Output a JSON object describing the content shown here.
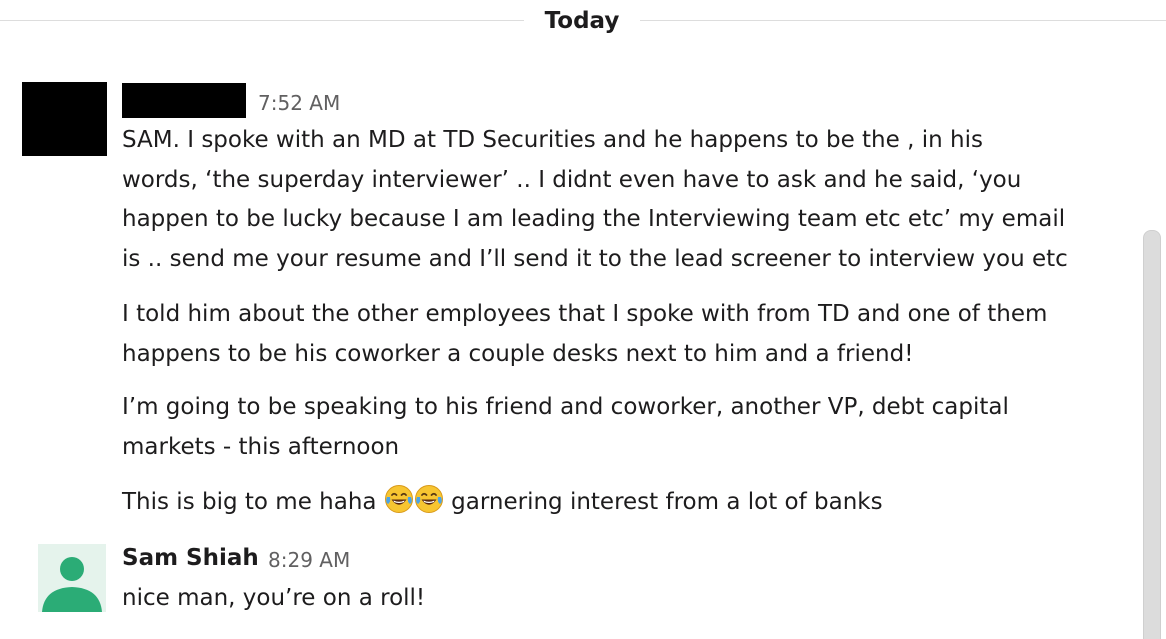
{
  "divider": {
    "label": "Today"
  },
  "messages": [
    {
      "sender_redacted": true,
      "time": "7:52 AM",
      "paragraphs": [
        {
          "lines": [
            "SAM. I spoke with an MD at TD Securities and he happens to be the , in his",
            "words, ‘the superday interviewer’ .. I didnt even have to ask and he said, ‘you",
            "happen to be lucky because I am leading the Interviewing team etc etc’ my email",
            "is .. send me your resume and I’ll send it to the lead screener to interview you etc"
          ]
        },
        {
          "lines": [
            "I told him about the other employees that I spoke with from TD and one of them",
            "happens to be his coworker a couple desks next to him and a friend!"
          ]
        },
        {
          "lines": [
            "I’m going to be speaking to his friend and coworker, another VP, debt capital",
            "markets - this afternoon"
          ]
        },
        {
          "before_emoji": "This is big to me haha ",
          "emojis": [
            "tears-of-joy-emoji",
            "tears-of-joy-emoji"
          ],
          "after_emoji": " garnering interest from a lot of banks"
        }
      ]
    },
    {
      "sender": "Sam Shiah",
      "time": "8:29 AM",
      "avatar_icon": "person-icon",
      "text": "nice man, you’re on a roll!"
    }
  ],
  "colors": {
    "text": "#1d1c1d",
    "muted": "#616061",
    "avatar_bg": "#e5f3ec",
    "avatar_fg": "#2bac76",
    "divider": "#dddddd"
  }
}
